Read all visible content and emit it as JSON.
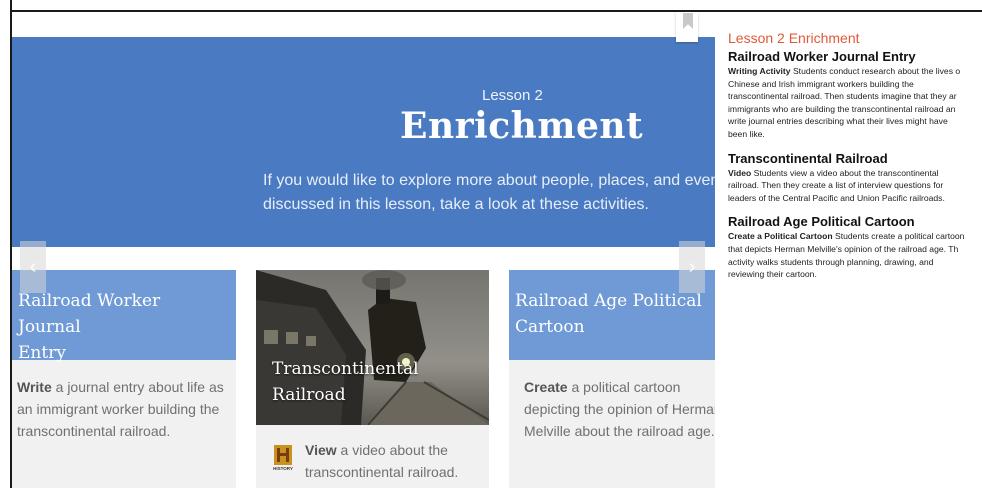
{
  "hero": {
    "kicker": "Lesson 2",
    "title": "Enrichment",
    "description_line1": "If you would like to explore more about people, places, and events",
    "description_line2": "discussed in this lesson, take a look at these activities."
  },
  "nav": {
    "prev_icon": "chevron-left-icon",
    "next_icon": "chevron-right-icon",
    "prev_glyph": "‹",
    "next_glyph": "›"
  },
  "cards": [
    {
      "title_line1": "Railroad Worker Journal",
      "title_line2": "Entry",
      "verb": "Write",
      "text_line1": " a journal entry about life as",
      "text_line2": "an immigrant worker building the",
      "text_line3": "transcontinental railroad."
    },
    {
      "title_line1": "Transcontinental",
      "title_line2": "Railroad",
      "verb": "View",
      "text_line1": " a video about the",
      "text_line2": "transcontinental railroad.",
      "logo": "HISTORY"
    },
    {
      "title_line1": "Railroad Age Political",
      "title_line2": "Cartoon",
      "verb": "Create",
      "text_line1": " a political cartoon",
      "text_line2": "depicting the opinion of Herman",
      "text_line3": "Melville about the railroad age."
    }
  ],
  "panel": {
    "heading": "Lesson 2 Enrichment",
    "items": [
      {
        "title": "Railroad Worker Journal Entry",
        "type": "Writing Activity",
        "lines": [
          "  Students conduct research about the lives o",
          "Chinese and Irish immigrant workers building the",
          "transcontinental railroad. Then students imagine that they ar",
          "immigrants who are building the transcontinental railroad an",
          "write journal entries describing what their lives might have",
          "been like."
        ]
      },
      {
        "title": "Transcontinental Railroad",
        "type": "Video",
        "lines": [
          "  Students view a video about the transcontinental",
          "railroad. Then they create a list of interview questions for",
          "leaders of the Central Pacific and Union Pacific railroads."
        ]
      },
      {
        "title": "Railroad Age Political Cartoon",
        "type": "Create a Political Cartoon",
        "lines": [
          "  Students create a political cartoon",
          "that depicts Herman Melville's opinion of the railroad age. Th",
          "activity walks students through planning, drawing, and",
          "reviewing their cartoon."
        ]
      }
    ]
  },
  "colors": {
    "hero_bg": "#4a7bc2",
    "card_head_bg": "#6f9ad6",
    "panel_heading": "#e05a39",
    "card_bg": "#f1f1f1"
  }
}
